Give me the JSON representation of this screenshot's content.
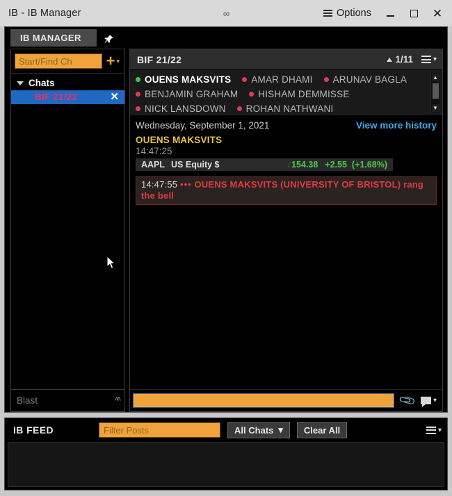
{
  "window": {
    "title": "IB - IB Manager",
    "mid_icon": "link-icon",
    "options_label": "Options",
    "minimize_label": "minimize",
    "maximize_label": "maximize",
    "close_label": "close"
  },
  "tabstrip": {
    "tabs": [
      {
        "label": "IB MANAGER"
      }
    ],
    "pin_icon": "pin-icon"
  },
  "sidebar": {
    "find_channel_placeholder": "Start/Find Ch",
    "add_label": "+",
    "tree": {
      "group_label": "Chats",
      "items": [
        {
          "label": "BIF 21/22",
          "close_label": "✕"
        }
      ]
    },
    "blast_label": "Blast",
    "blast_chevron": "«"
  },
  "chat": {
    "title": "BIF 21/22",
    "member_count": "1/11",
    "participants": [
      {
        "name": "OUENS MAKSVITS",
        "status": "online",
        "color": "#3ec93e"
      },
      {
        "name": "AMAR DHAMI",
        "status": "offline",
        "color": "#e03c5a"
      },
      {
        "name": "ARUNAV BAGLA",
        "status": "offline",
        "color": "#e03c5a"
      },
      {
        "name": "BENJAMIN GRAHAM",
        "status": "offline",
        "color": "#e03c5a"
      },
      {
        "name": "HISHAM DEMMISSE",
        "status": "offline",
        "color": "#e03c5a"
      },
      {
        "name": "NICK LANSDOWN",
        "status": "offline",
        "color": "#e03c5a"
      },
      {
        "name": "ROHAN NATHWANI",
        "status": "offline",
        "color": "#e03c5a"
      }
    ],
    "date_divider": "Wednesday, September 1, 2021",
    "view_more_history": "View more history",
    "message": {
      "sender": "OUENS MAKSVITS",
      "time": "14:47:25",
      "quote": {
        "ticker": "AAPL",
        "description": "US Equity $",
        "direction_arrow": "↓",
        "price": "154.38",
        "change": "+2.55",
        "percent": "(+1.68%)"
      }
    },
    "alert": {
      "time": "14:47:55",
      "dots": "•••",
      "text": "OUENS MAKSVITS (UNIVERSITY OF BRISTOL) rang the bell"
    },
    "compose_value": "",
    "attach_icon": "paperclip-icon",
    "flag_icon": "flag-icon"
  },
  "feed": {
    "title": "IB FEED",
    "filter_placeholder": "Filter Posts",
    "scope_label": "All Chats",
    "clear_label": "Clear All"
  },
  "colors": {
    "accent_orange": "#f0a33c",
    "selection_blue": "#1f68c4",
    "link_blue": "#3fa9e8",
    "sender_yellow": "#e8c341",
    "alert_red": "#e03c3c",
    "positive_green": "#49c949"
  }
}
